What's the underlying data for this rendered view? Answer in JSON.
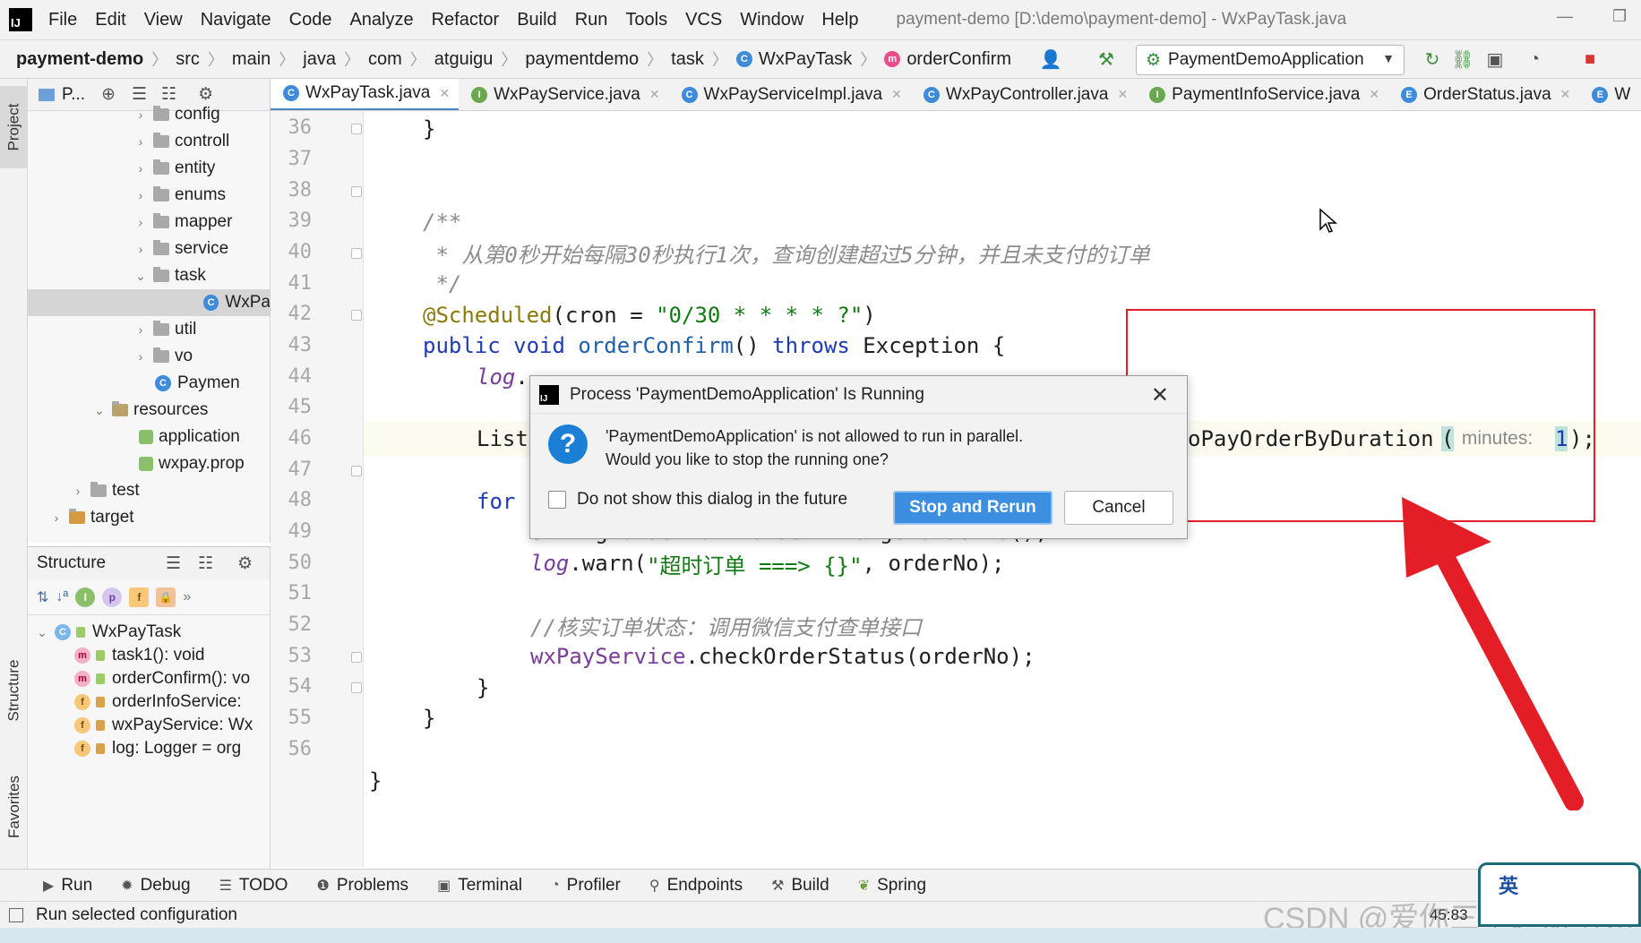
{
  "menubar": {
    "items": [
      "File",
      "Edit",
      "View",
      "Navigate",
      "Code",
      "Analyze",
      "Refactor",
      "Build",
      "Run",
      "Tools",
      "VCS",
      "Window",
      "Help"
    ],
    "title": "payment-demo [D:\\demo\\payment-demo] - WxPayTask.java"
  },
  "breadcrumb": {
    "items": [
      "payment-demo",
      "src",
      "main",
      "java",
      "com",
      "atguigu",
      "paymentdemo",
      "task",
      "WxPayTask",
      "orderConfirm"
    ]
  },
  "run_config": {
    "label": "PaymentDemoApplication"
  },
  "project_panel": {
    "header": "P...",
    "rows": [
      {
        "label": "config",
        "kind": "folder",
        "expanded": false
      },
      {
        "label": "controll",
        "kind": "folder",
        "expanded": false
      },
      {
        "label": "entity",
        "kind": "folder",
        "expanded": false
      },
      {
        "label": "enums",
        "kind": "folder",
        "expanded": false
      },
      {
        "label": "mapper",
        "kind": "folder",
        "expanded": false
      },
      {
        "label": "service",
        "kind": "folder",
        "expanded": false
      },
      {
        "label": "task",
        "kind": "folder",
        "expanded": true
      },
      {
        "label": "WxPa",
        "kind": "class",
        "selected": true
      },
      {
        "label": "util",
        "kind": "folder",
        "expanded": false
      },
      {
        "label": "vo",
        "kind": "folder",
        "expanded": false
      },
      {
        "label": "Paymen",
        "kind": "app"
      },
      {
        "label": "resources",
        "kind": "resfolder",
        "expanded": true
      },
      {
        "label": "application",
        "kind": "file"
      },
      {
        "label": "wxpay.prop",
        "kind": "file"
      },
      {
        "label": "test",
        "kind": "folder",
        "expanded": false
      },
      {
        "label": "target",
        "kind": "folder-orange",
        "expanded": false
      }
    ]
  },
  "structure_panel": {
    "header": "Structure",
    "root": "WxPayTask",
    "members": [
      {
        "badge": "m",
        "label": "task1(): void"
      },
      {
        "badge": "m",
        "label": "orderConfirm(): vo"
      },
      {
        "badge": "f",
        "label": "orderInfoService:"
      },
      {
        "badge": "f",
        "label": "wxPayService: Wx"
      },
      {
        "badge": "f",
        "label": "log: Logger = org"
      }
    ]
  },
  "left_stripe": {
    "project": "Project",
    "structure": "Structure",
    "favorites": "Favorites"
  },
  "editor_tabs": [
    {
      "icon": "C",
      "label": "WxPayTask.java",
      "active": true
    },
    {
      "icon": "I",
      "label": "WxPayService.java"
    },
    {
      "icon": "C",
      "label": "WxPayServiceImpl.java"
    },
    {
      "icon": "C",
      "label": "WxPayController.java"
    },
    {
      "icon": "I",
      "label": "PaymentInfoService.java"
    },
    {
      "icon": "E",
      "label": "OrderStatus.java"
    },
    {
      "icon": "E",
      "label": "W"
    }
  ],
  "code": {
    "line_numbers": [
      "36",
      "37",
      "38",
      "39",
      "40",
      "41",
      "42",
      "43",
      "44",
      "45",
      "46",
      "47",
      "48",
      "49",
      "50",
      "51",
      "52",
      "53",
      "54",
      "55",
      "56"
    ],
    "l36": "}",
    "l38": "/**",
    "l39": " * 从第0秒开始每隔30秒执行1次，查询创建超过5分钟，并且未支付的订单",
    "l40": " */",
    "l41_ann": "@Scheduled",
    "l41_a": "(cron = ",
    "l41_str": "\"0/30 * * * * ?\"",
    "l41_b": ")",
    "l42_kw1": "public void ",
    "l42_meth": "orderConfirm",
    "l42_a": "() ",
    "l42_kw2": "throws",
    "l42_b": " Exception {",
    "l43_fld": "log",
    "l43_a": ".",
    "l45_a": "List",
    "l45_b": "oPayOrderByDuration",
    "l45_hint": " minutes: ",
    "l45_num": "1",
    "l45_c": ");",
    "l47_kw": "for",
    "l48": "String orderNo = orderInfo.getOrderNo();",
    "l49_fld": "log",
    "l49_a": ".warn(",
    "l49_str": "\"超时订单 ===> {}\"",
    "l49_b": ", orderNo);",
    "l51": "//核实订单状态：调用微信支付查单接口",
    "l52_fld": "wxPayService",
    "l52_a": ".checkOrderStatus(orderNo);",
    "l53": "}",
    "l54": "}",
    "l56": "}"
  },
  "dialog": {
    "title": "Process 'PaymentDemoApplication' Is Running",
    "message_line1": "'PaymentDemoApplication' is not allowed to run in parallel.",
    "message_line2": "Would you like to stop the running one?",
    "checkbox_label": "Do not show this dialog in the future",
    "checkbox_checked": false,
    "primary_button": "Stop and Rerun",
    "cancel_button": "Cancel"
  },
  "bottom_tools": [
    {
      "icon": "run-icon",
      "label": "Run"
    },
    {
      "icon": "debug-icon",
      "label": "Debug"
    },
    {
      "icon": "todo-icon",
      "label": "TODO"
    },
    {
      "icon": "problems-icon",
      "label": "Problems"
    },
    {
      "icon": "terminal-icon",
      "label": "Terminal"
    },
    {
      "icon": "profiler-icon",
      "label": "Profiler"
    },
    {
      "icon": "endpoints-icon",
      "label": "Endpoints"
    },
    {
      "icon": "build-icon",
      "label": "Build"
    },
    {
      "icon": "spring-icon",
      "label": "Spring"
    }
  ],
  "status": {
    "message": "Run selected configuration",
    "time": "45:83"
  },
  "watermark": "CSDN @爱你三千遍斯塔克",
  "ime": {
    "label": "英"
  },
  "colors": {
    "accent": "#3c8fe0",
    "annotation_red": "#e41e26"
  }
}
